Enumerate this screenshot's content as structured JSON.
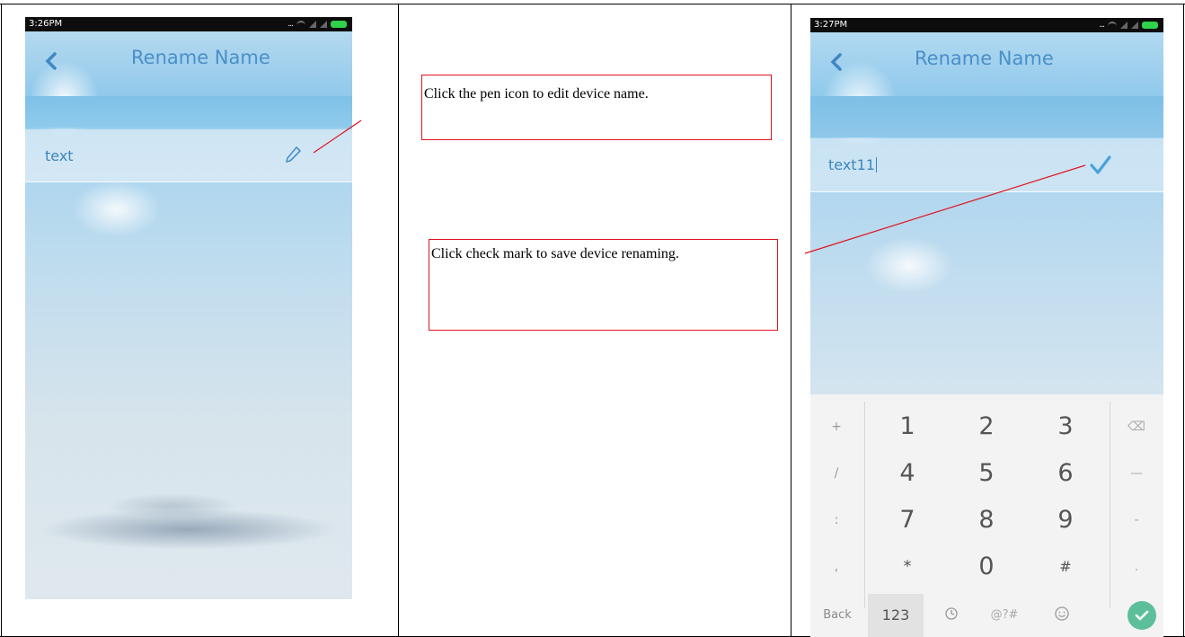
{
  "left_screen": {
    "status_time": "3:26PM",
    "status_dots": "...",
    "title": "Rename Name",
    "device_name": "text"
  },
  "right_screen": {
    "status_time": "3:27PM",
    "status_dots": "...",
    "title": "Rename Name",
    "device_name_input": "text11",
    "keyboard": {
      "rows": [
        {
          "side": "+",
          "keys": [
            "1",
            "2",
            "3"
          ],
          "right": "⌫"
        },
        {
          "side": "/",
          "keys": [
            "4",
            "5",
            "6"
          ],
          "right": "—"
        },
        {
          "side": ":",
          "keys": [
            "7",
            "8",
            "9"
          ],
          "right": "-"
        },
        {
          "side": ",",
          "keys": [
            "*",
            "0",
            "#"
          ],
          "right": "."
        }
      ],
      "bottom": {
        "back": "Back",
        "mode": "123",
        "symbols": "@?#"
      }
    }
  },
  "annotations": {
    "pen_note": "Click the pen icon to edit device name.",
    "check_note": "Click check mark to save device renaming."
  },
  "colors": {
    "accent": "#4a8fc9",
    "annotation_border": "#e0141e",
    "confirm_key": "#5cbf9a"
  }
}
